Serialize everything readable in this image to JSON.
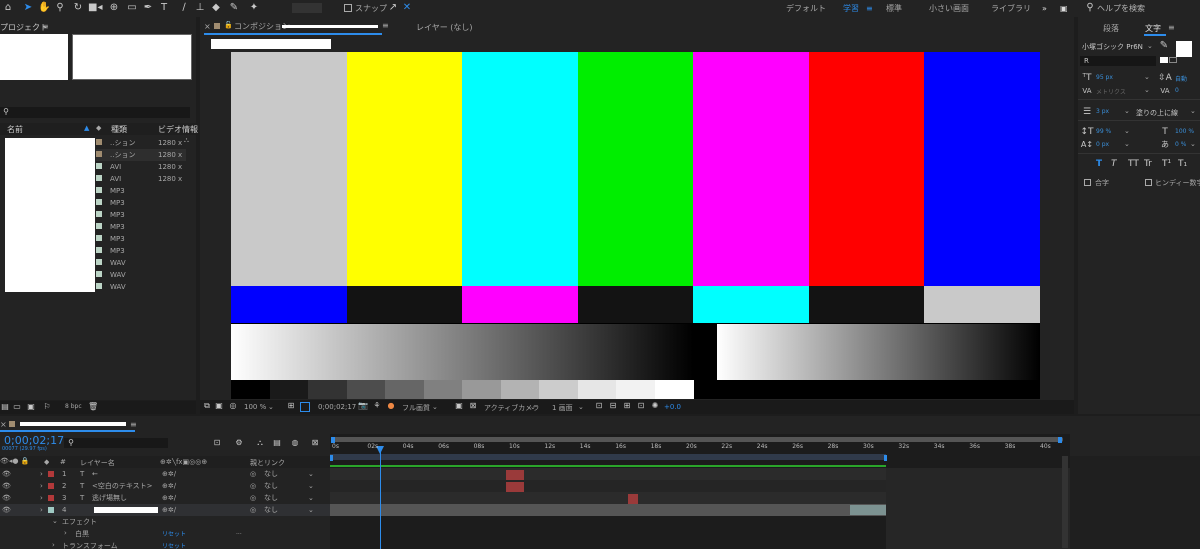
{
  "toolbar": {
    "snap_label": "スナップ",
    "workspaces": [
      "デフォルト",
      "学習",
      "標準",
      "小さい画面",
      "ライブラリ"
    ],
    "active_workspace": "学習",
    "help_placeholder": "ヘルプを検索"
  },
  "project": {
    "title": "プロジェクト",
    "columns": [
      "名前",
      "種類",
      "ビデオ情報"
    ],
    "items": [
      {
        "type": "..ション",
        "info": "1280 x",
        "color": "#a08c70"
      },
      {
        "type": "..ション",
        "info": "1280 x",
        "color": "#a08c70"
      },
      {
        "type": "AVI",
        "info": "1280 x",
        "color": "#bcd5c6"
      },
      {
        "type": "AVI",
        "info": "1280 x",
        "color": "#bcd5c6"
      },
      {
        "type": "MP3",
        "info": "",
        "color": "#bcd5c6"
      },
      {
        "type": "MP3",
        "info": "",
        "color": "#bcd5c6"
      },
      {
        "type": "MP3",
        "info": "",
        "color": "#bcd5c6"
      },
      {
        "type": "MP3",
        "info": "",
        "color": "#bcd5c6"
      },
      {
        "type": "MP3",
        "info": "",
        "color": "#bcd5c6"
      },
      {
        "type": "MP3",
        "info": "",
        "color": "#bcd5c6"
      },
      {
        "type": "WAV",
        "info": "",
        "color": "#bcd5c6"
      },
      {
        "type": "WAV",
        "info": "",
        "color": "#bcd5c6"
      },
      {
        "type": "WAV",
        "info": "",
        "color": "#bcd5c6"
      }
    ],
    "bpc_label": "8 bpc"
  },
  "composition": {
    "tab_prefix": "コンポジション",
    "layer_tab": "レイヤー (なし)",
    "zoom": "100 %",
    "timecode": "0;00;02;17",
    "resolution": "フル画質",
    "camera": "アクティブカメラ",
    "views": "1 画面",
    "exposure": "+0.0"
  },
  "color_bars": {
    "top": [
      "#c9c9c9",
      "#ffff00",
      "#00ffff",
      "#00ee00",
      "#ff00ff",
      "#ff0000",
      "#0000ff"
    ],
    "middle": [
      "#0000ff",
      "#131313",
      "#ff00ff",
      "#131313",
      "#00ffff",
      "#131313",
      "#c9c9c9"
    ],
    "steps": [
      "#000000",
      "#1a1a1a",
      "#333333",
      "#4d4d4d",
      "#666666",
      "#808080",
      "#999999",
      "#b3b3b3",
      "#cccccc",
      "#e6e6e6",
      "#f2f2f2",
      "#ffffff"
    ]
  },
  "character": {
    "tabs": [
      "段落",
      "文字"
    ],
    "active_tab": "文字",
    "font_family": "小塚ゴシック Pr6N",
    "font_style": "R",
    "size": "95 px",
    "leading": "自動",
    "kerning": "メトリクス",
    "tracking": "0",
    "stroke_width": "3 px",
    "stroke_mode": "塗りの上に線",
    "vertical_scale": "99 %",
    "horizontal_scale": "100 %",
    "baseline_shift": "0 px",
    "tsume": "0 %",
    "style_buttons": [
      "T",
      "T",
      "TT",
      "Tr",
      "T¹",
      "T₁"
    ],
    "ligature_label": "合字",
    "hindi_label": "ヒンディー数字"
  },
  "timeline": {
    "timecode": "0;00;02;17",
    "fps": "00077 (29.97 fps)",
    "columns": {
      "label": "#",
      "layer_name": "レイヤー名",
      "parent": "親とリンク"
    },
    "ruler": [
      "0s",
      "02s",
      "04s",
      "06s",
      "08s",
      "10s",
      "12s",
      "14s",
      "16s",
      "18s",
      "20s",
      "22s",
      "24s",
      "26s",
      "28s",
      "30s",
      "32s",
      "34s",
      "36s",
      "38s",
      "40s"
    ],
    "layers": [
      {
        "num": "1",
        "kind": "T",
        "name": "←",
        "parent": "なし",
        "color": "#b2393a"
      },
      {
        "num": "2",
        "kind": "T",
        "name": "<空白のテキスト>",
        "parent": "なし",
        "color": "#b2393a"
      },
      {
        "num": "3",
        "kind": "T",
        "name": "逃げ場無し",
        "parent": "なし",
        "color": "#b2393a"
      },
      {
        "num": "4",
        "kind": "",
        "name": "",
        "parent": "なし",
        "color": "#9fc9c3"
      }
    ],
    "effects_label": "エフェクト",
    "effect_name": "白黒",
    "transform_label": "トランスフォーム",
    "reset_label": "リセット"
  }
}
